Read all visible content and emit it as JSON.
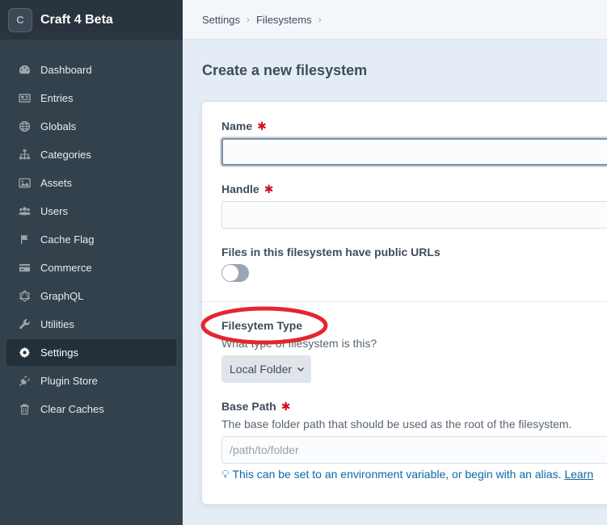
{
  "sidebar": {
    "site_name": "Craft 4 Beta",
    "logo_letter": "C",
    "items": [
      {
        "label": "Dashboard",
        "icon": "gauge-icon"
      },
      {
        "label": "Entries",
        "icon": "newspaper-icon"
      },
      {
        "label": "Globals",
        "icon": "globe-icon"
      },
      {
        "label": "Categories",
        "icon": "sitemap-icon"
      },
      {
        "label": "Assets",
        "icon": "image-icon"
      },
      {
        "label": "Users",
        "icon": "users-icon"
      },
      {
        "label": "Cache Flag",
        "icon": "flag-icon"
      },
      {
        "label": "Commerce",
        "icon": "credit-card-icon"
      },
      {
        "label": "GraphQL",
        "icon": "graphql-icon"
      },
      {
        "label": "Utilities",
        "icon": "wrench-icon"
      },
      {
        "label": "Settings",
        "icon": "gear-icon",
        "active": true
      },
      {
        "label": "Plugin Store",
        "icon": "plug-icon"
      },
      {
        "label": "Clear Caches",
        "icon": "trash-icon"
      }
    ]
  },
  "breadcrumb": {
    "items": [
      "Settings",
      "Filesystems"
    ]
  },
  "page": {
    "title": "Create a new filesystem"
  },
  "form": {
    "name_label": "Name",
    "name_value": "",
    "handle_label": "Handle",
    "handle_value": "",
    "public_urls_label": "Files in this filesystem have public URLs",
    "public_urls_enabled": false,
    "type_label": "Filesytem Type",
    "type_instructions": "What type of filesystem is this?",
    "type_selected": "Local Folder",
    "base_path_label": "Base Path",
    "base_path_instructions": "The base folder path that should be used as the root of the filesystem.",
    "base_path_placeholder": "/path/to/folder",
    "base_path_tip": "This can be set to an environment variable, or begin with an alias.",
    "learn_link": "Learn"
  },
  "colors": {
    "sidebar_bg": "#33414d",
    "required": "#cf1124",
    "link": "#0b69a3",
    "annotation": "#e5262e"
  }
}
